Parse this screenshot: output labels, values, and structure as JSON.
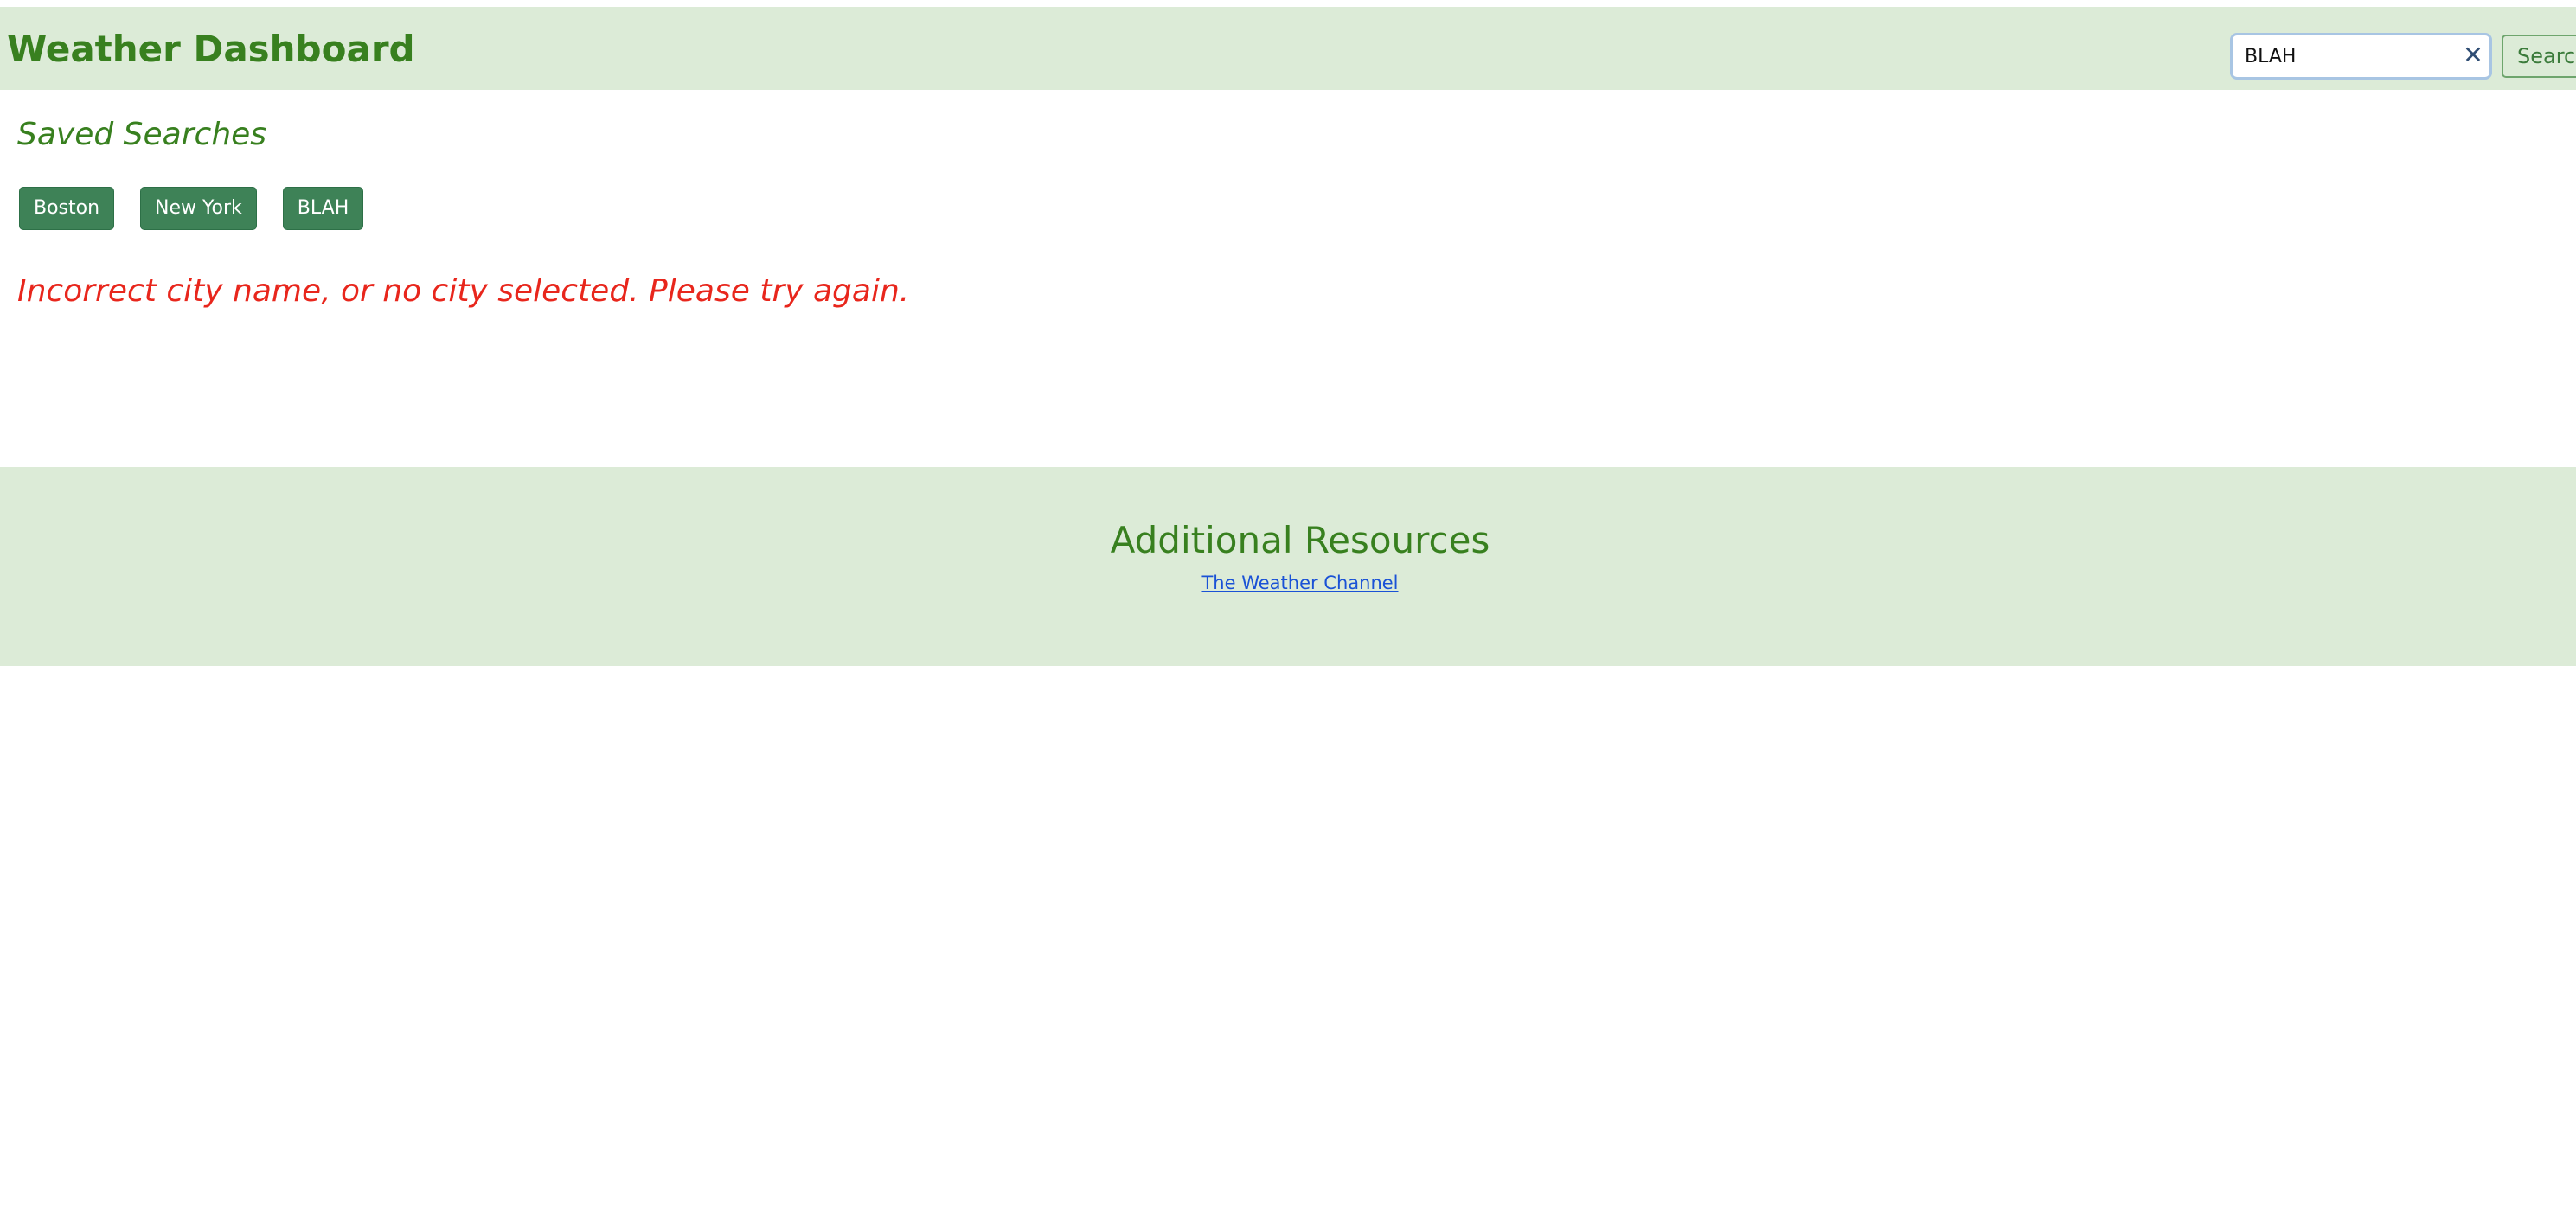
{
  "header": {
    "title": "Weather Dashboard",
    "search": {
      "value": "BLAH",
      "clear_icon": "close-icon",
      "button_label": "Search"
    }
  },
  "saved_searches": {
    "heading": "Saved Searches",
    "items": [
      {
        "label": "Boston"
      },
      {
        "label": "New York"
      },
      {
        "label": "BLAH"
      }
    ]
  },
  "error": {
    "message": "Incorrect city name, or no city selected. Please try again."
  },
  "footer": {
    "heading": "Additional Resources",
    "link_label": "The Weather Channel"
  },
  "colors": {
    "brand_green": "#38801f",
    "header_bg": "#dcebd7",
    "button_green": "#3e8257",
    "error_red": "#e8261c",
    "link_blue": "#1a52d6"
  }
}
